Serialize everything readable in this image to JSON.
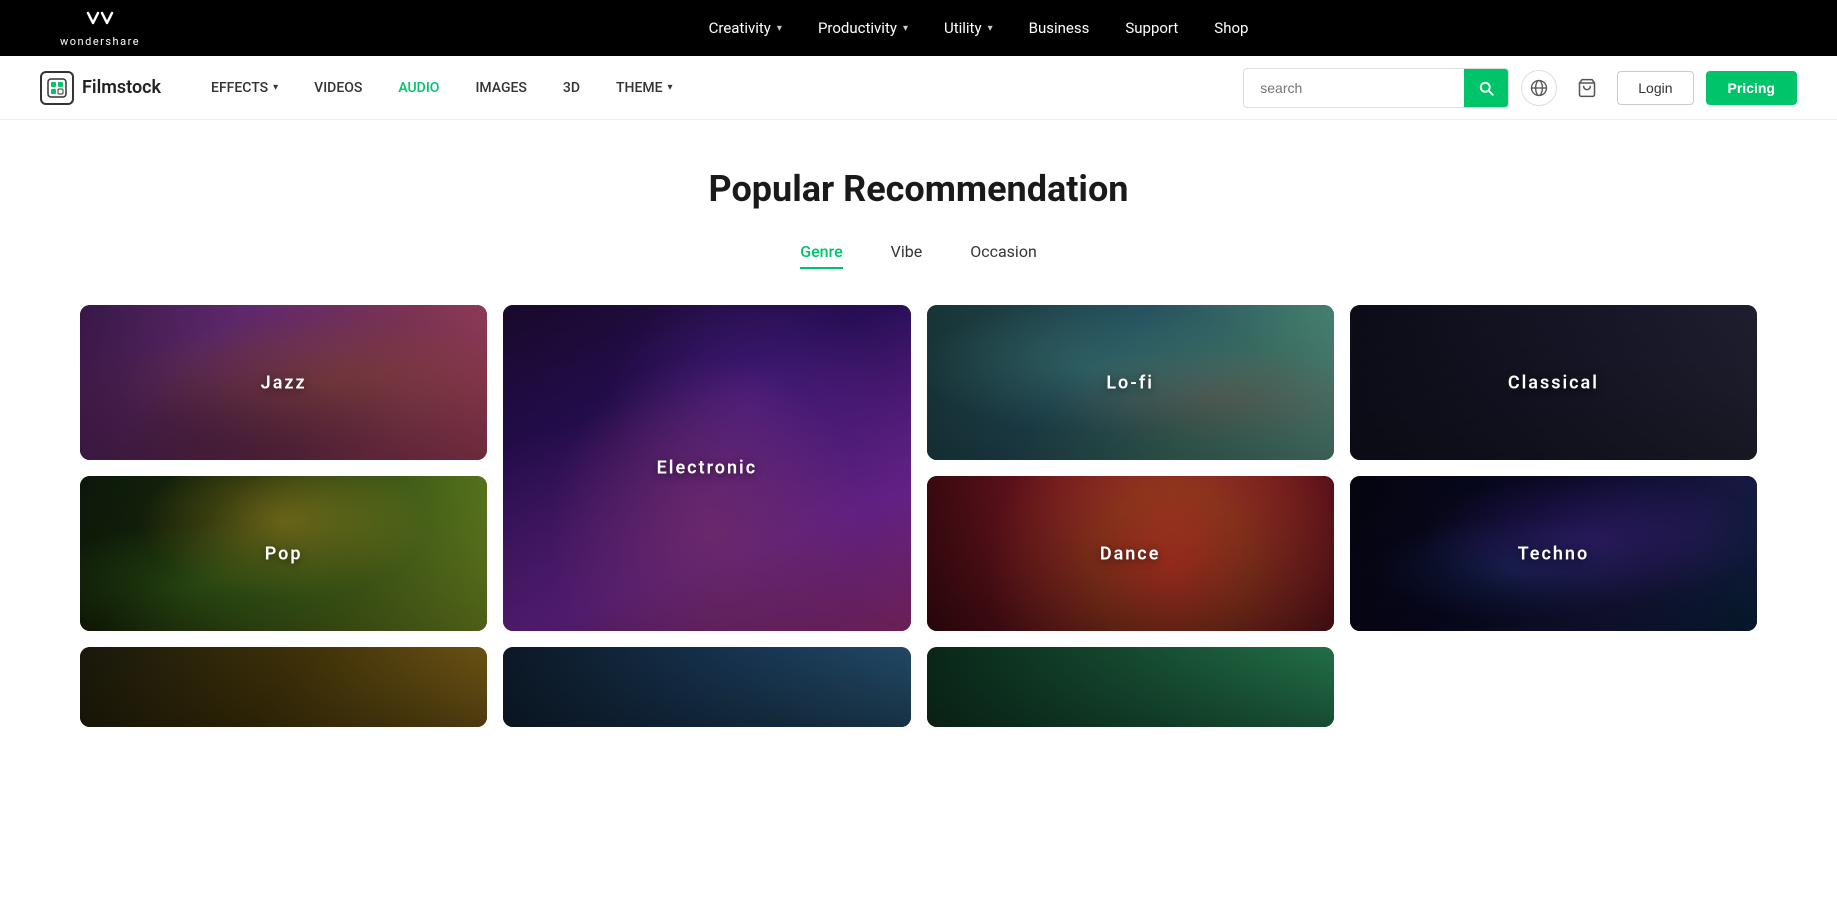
{
  "topNav": {
    "logo": {
      "text": "wondershare"
    },
    "items": [
      {
        "label": "Creativity",
        "hasDropdown": true
      },
      {
        "label": "Productivity",
        "hasDropdown": true
      },
      {
        "label": "Utility",
        "hasDropdown": true
      },
      {
        "label": "Business",
        "hasDropdown": false
      },
      {
        "label": "Support",
        "hasDropdown": false
      },
      {
        "label": "Shop",
        "hasDropdown": false
      }
    ]
  },
  "secondNav": {
    "brand": "Filmstock",
    "items": [
      {
        "label": "EFFECTS",
        "hasDropdown": true,
        "active": false
      },
      {
        "label": "VIDEOS",
        "hasDropdown": false,
        "active": false
      },
      {
        "label": "AUDIO",
        "hasDropdown": false,
        "active": true
      },
      {
        "label": "IMAGES",
        "hasDropdown": false,
        "active": false
      },
      {
        "label": "3D",
        "hasDropdown": false,
        "active": false
      },
      {
        "label": "THEME",
        "hasDropdown": true,
        "active": false
      }
    ],
    "search": {
      "placeholder": "search"
    },
    "loginLabel": "Login",
    "pricingLabel": "Pricing"
  },
  "mainContent": {
    "title": "Popular Recommendation",
    "tabs": [
      {
        "label": "Genre",
        "active": true
      },
      {
        "label": "Vibe",
        "active": false
      },
      {
        "label": "Occasion",
        "active": false
      }
    ],
    "genres": [
      {
        "label": "Jazz",
        "size": "normal",
        "bg": "jazz"
      },
      {
        "label": "Electronic",
        "size": "tall",
        "bg": "electronic"
      },
      {
        "label": "Lo-fi",
        "size": "normal",
        "bg": "lofi"
      },
      {
        "label": "Classical",
        "size": "normal",
        "bg": "classical"
      },
      {
        "label": "Pop",
        "size": "normal",
        "bg": "pop"
      },
      {
        "label": "Dance",
        "size": "normal",
        "bg": "dance"
      },
      {
        "label": "Techno",
        "size": "normal",
        "bg": "techno"
      }
    ],
    "bottomCards": [
      {
        "label": "",
        "bg": "bottom1"
      },
      {
        "label": "",
        "bg": "bottom2"
      },
      {
        "label": "",
        "bg": "bottom3"
      }
    ]
  }
}
